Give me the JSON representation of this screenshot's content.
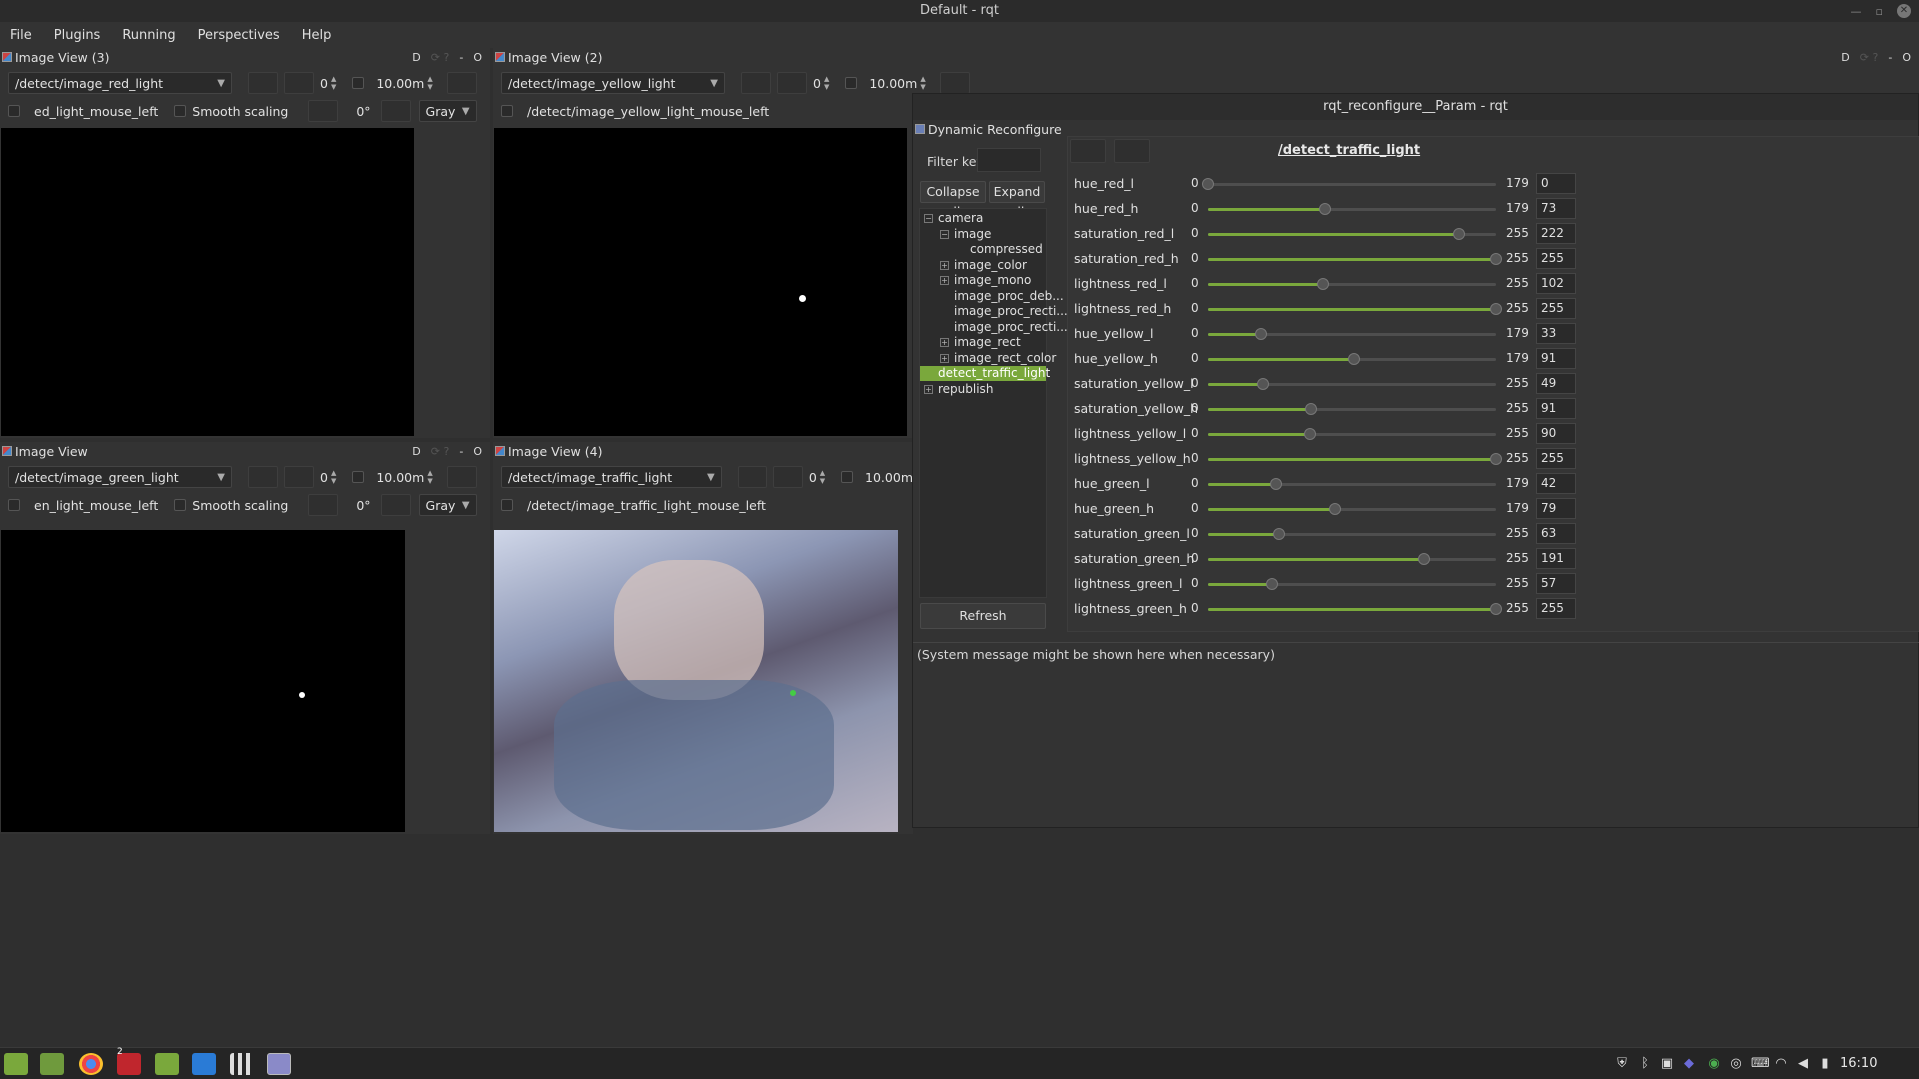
{
  "window_title": "Default - rqt",
  "menu": [
    "File",
    "Plugins",
    "Running",
    "Perspectives",
    "Help"
  ],
  "dock_buttons": {
    "d": "D",
    "min": "-",
    "close": "O"
  },
  "views": {
    "v3": {
      "title": "Image View (3)",
      "topic": "/detect/image_red_light",
      "spin_value": "0",
      "period": "10.00m",
      "mouse_topic": "ed_light_mouse_left",
      "smooth": "Smooth scaling",
      "rotation": "0°",
      "color_mode": "Gray"
    },
    "v2": {
      "title": "Image View (2)",
      "topic": "/detect/image_yellow_light",
      "spin_value": "0",
      "period": "10.00m",
      "mouse_topic": "/detect/image_yellow_light_mouse_left"
    },
    "v1": {
      "title": "Image View",
      "topic": "/detect/image_green_light",
      "spin_value": "0",
      "period": "10.00m",
      "mouse_topic": "en_light_mouse_left",
      "smooth": "Smooth scaling",
      "rotation": "0°",
      "color_mode": "Gray"
    },
    "v4": {
      "title": "Image View (4)",
      "topic": "/detect/image_traffic_light",
      "spin_value": "0",
      "period": "10.00m",
      "mouse_topic": "/detect/image_traffic_light_mouse_left"
    }
  },
  "reconfigure": {
    "window_title": "rqt_reconfigure__Param - rqt",
    "subtitle": "Dynamic Reconfigure",
    "filter_label": "Filter key:",
    "collapse_all": "Collapse all",
    "expand_all": "Expand all",
    "refresh": "Refresh",
    "node_title": "/detect_traffic_light",
    "system_message": "(System message might be shown here when necessary)",
    "tree": [
      {
        "label": "camera",
        "pm": "−"
      },
      {
        "label": "image",
        "pm": "−"
      },
      {
        "label": "compressed",
        "pm": ""
      },
      {
        "label": "image_color",
        "pm": "+"
      },
      {
        "label": "image_mono",
        "pm": "+"
      },
      {
        "label": "image_proc_deb...",
        "pm": ""
      },
      {
        "label": "image_proc_recti...",
        "pm": ""
      },
      {
        "label": "image_proc_recti...",
        "pm": ""
      },
      {
        "label": "image_rect",
        "pm": "+"
      },
      {
        "label": "image_rect_color",
        "pm": "+"
      },
      {
        "label": "detect_traffic_light",
        "pm": ""
      },
      {
        "label": "republish",
        "pm": "+"
      }
    ],
    "params": [
      {
        "name": "hue_red_l",
        "min": "0",
        "max": "179",
        "value": "0"
      },
      {
        "name": "hue_red_h",
        "min": "0",
        "max": "179",
        "value": "73"
      },
      {
        "name": "saturation_red_l",
        "min": "0",
        "max": "255",
        "value": "222"
      },
      {
        "name": "saturation_red_h",
        "min": "0",
        "max": "255",
        "value": "255"
      },
      {
        "name": "lightness_red_l",
        "min": "0",
        "max": "255",
        "value": "102"
      },
      {
        "name": "lightness_red_h",
        "min": "0",
        "max": "255",
        "value": "255"
      },
      {
        "name": "hue_yellow_l",
        "min": "0",
        "max": "179",
        "value": "33"
      },
      {
        "name": "hue_yellow_h",
        "min": "0",
        "max": "179",
        "value": "91"
      },
      {
        "name": "saturation_yellow_l",
        "min": "0",
        "max": "255",
        "value": "49"
      },
      {
        "name": "saturation_yellow_h",
        "min": "0",
        "max": "255",
        "value": "91"
      },
      {
        "name": "lightness_yellow_l",
        "min": "0",
        "max": "255",
        "value": "90"
      },
      {
        "name": "lightness_yellow_h",
        "min": "0",
        "max": "255",
        "value": "255"
      },
      {
        "name": "hue_green_l",
        "min": "0",
        "max": "179",
        "value": "42"
      },
      {
        "name": "hue_green_h",
        "min": "0",
        "max": "179",
        "value": "79"
      },
      {
        "name": "saturation_green_l",
        "min": "0",
        "max": "255",
        "value": "63"
      },
      {
        "name": "saturation_green_h",
        "min": "0",
        "max": "255",
        "value": "191"
      },
      {
        "name": "lightness_green_l",
        "min": "0",
        "max": "255",
        "value": "57"
      },
      {
        "name": "lightness_green_h",
        "min": "0",
        "max": "255",
        "value": "255"
      }
    ]
  },
  "taskbar": {
    "clock": "16:10",
    "terminal_badge": "2"
  },
  "colors": {
    "accent": "#7aa83c",
    "background": "#333333"
  }
}
